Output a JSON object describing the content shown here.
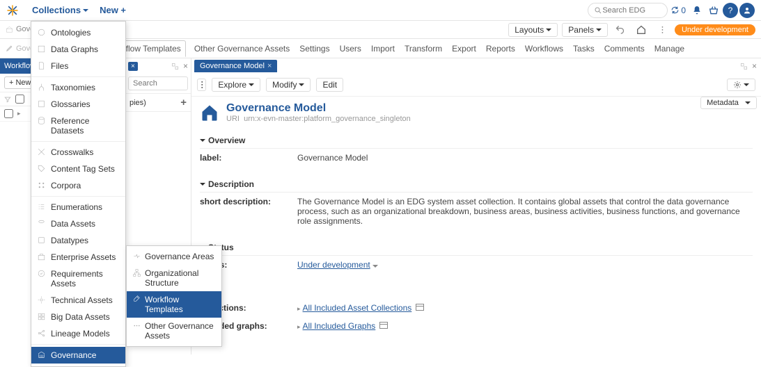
{
  "topbar": {
    "collections_label": "Collections",
    "new_label": "New +",
    "search_placeholder": "Search EDG",
    "refresh_count": "0"
  },
  "secondbar": {
    "layouts": "Layouts",
    "panels": "Panels",
    "status_pill": "Under development"
  },
  "breadcrumb": {
    "line1": "Governa",
    "line2": "Governanc",
    "line3": "Governa"
  },
  "menubar": {
    "items": [
      "re",
      "Workflow Templates",
      "Other Governance Assets",
      "Settings",
      "Users",
      "Import",
      "Transform",
      "Export",
      "Reports",
      "Workflows",
      "Tasks",
      "Comments",
      "Manage"
    ],
    "active_index": 1
  },
  "leftpanel": {
    "tab_label": "Workflow T",
    "new_btn": "+ New",
    "row_label": ""
  },
  "midpanel": {
    "search_placeholder": "Search",
    "row_label": "pies)"
  },
  "rightpanel": {
    "tab_label": "Governance Model",
    "explore": "Explore",
    "modify": "Modify",
    "edit": "Edit",
    "metadata_btn": "Metadata"
  },
  "doc": {
    "title": "Governance Model",
    "uri_label": "URI",
    "uri": "urn:x-evn-master:platform_governance_singleton",
    "overview_h": "Overview",
    "label_k": "label:",
    "label_v": "Governance Model",
    "description_h": "Description",
    "short_desc_k": "short description:",
    "short_desc_v": "The Governance Model is an EDG system asset collection. It contains global assets that control the data governance process, such as an organizational breakdown, business areas, business activities, business functions, and governance role assignments.",
    "status_h": "Status",
    "status_k": "status:",
    "status_v": "Under development",
    "incl_coll_k": "collections:",
    "incl_coll_v": "All Included Asset Collections",
    "incl_graph_k": "included graphs:",
    "incl_graph_v": "All Included Graphs"
  },
  "dropdown": {
    "groups": [
      [
        "Ontologies",
        "Data Graphs",
        "Files"
      ],
      [
        "Taxonomies",
        "Glossaries",
        "Reference Datasets"
      ],
      [
        "Crosswalks",
        "Content Tag Sets",
        "Corpora"
      ],
      [
        "Enumerations",
        "Data Assets",
        "Datatypes",
        "Enterprise Assets",
        "Requirements Assets",
        "Technical Assets",
        "Big Data Assets",
        "Lineage Models"
      ],
      [
        "Governance"
      ]
    ],
    "selected": "Governance"
  },
  "submenu": {
    "items": [
      "Governance Areas",
      "Organizational Structure",
      "Workflow Templates",
      "Other Governance Assets"
    ],
    "selected": "Workflow Templates"
  },
  "section_partial": "es"
}
